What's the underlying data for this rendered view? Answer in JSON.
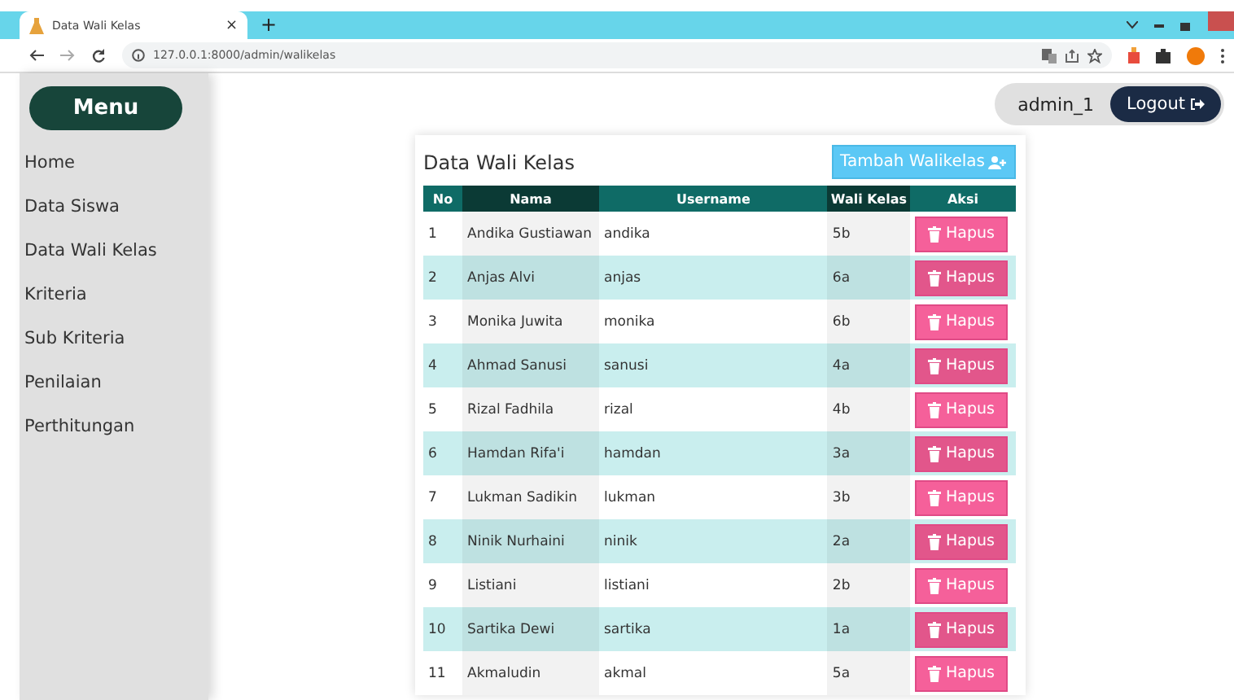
{
  "browser": {
    "tab_title": "Data Wali Kelas",
    "tab_close": "×",
    "new_tab": "+",
    "url": "127.0.0.1:8000/admin/walikelas"
  },
  "sidebar": {
    "menu_button": "Menu",
    "items": [
      {
        "label": "Home"
      },
      {
        "label": "Data Siswa"
      },
      {
        "label": "Data Wali Kelas"
      },
      {
        "label": "Kriteria"
      },
      {
        "label": "Sub Kriteria"
      },
      {
        "label": "Penilaian"
      },
      {
        "label": "Perthitungan"
      }
    ]
  },
  "user": {
    "name": "admin_1",
    "logout": "Logout"
  },
  "card": {
    "title": "Data Wali Kelas",
    "add_button": "Tambah Walikelas"
  },
  "table": {
    "columns": [
      "No",
      "Nama",
      "Username",
      "Wali Kelas",
      "Aksi"
    ],
    "rows": [
      {
        "no": "1",
        "nama": "Andika Gustiawan",
        "username": "andika",
        "kelas": "5b",
        "action": "Hapus"
      },
      {
        "no": "2",
        "nama": "Anjas Alvi",
        "username": "anjas",
        "kelas": "6a",
        "action": "Hapus"
      },
      {
        "no": "3",
        "nama": "Monika Juwita",
        "username": "monika",
        "kelas": "6b",
        "action": "Hapus"
      },
      {
        "no": "4",
        "nama": "Ahmad Sanusi",
        "username": "sanusi",
        "kelas": "4a",
        "action": "Hapus"
      },
      {
        "no": "5",
        "nama": "Rizal Fadhila",
        "username": "rizal",
        "kelas": "4b",
        "action": "Hapus"
      },
      {
        "no": "6",
        "nama": "Hamdan Rifa'i",
        "username": "hamdan",
        "kelas": "3a",
        "action": "Hapus"
      },
      {
        "no": "7",
        "nama": "Lukman Sadikin",
        "username": "lukman",
        "kelas": "3b",
        "action": "Hapus"
      },
      {
        "no": "8",
        "nama": "Ninik Nurhaini",
        "username": "ninik",
        "kelas": "2a",
        "action": "Hapus"
      },
      {
        "no": "9",
        "nama": "Listiani",
        "username": "listiani",
        "kelas": "2b",
        "action": "Hapus"
      },
      {
        "no": "10",
        "nama": "Sartika Dewi",
        "username": "sartika",
        "kelas": "1a",
        "action": "Hapus"
      },
      {
        "no": "11",
        "nama": "Akmaludin",
        "username": "akmal",
        "kelas": "5a",
        "action": "Hapus"
      }
    ]
  }
}
